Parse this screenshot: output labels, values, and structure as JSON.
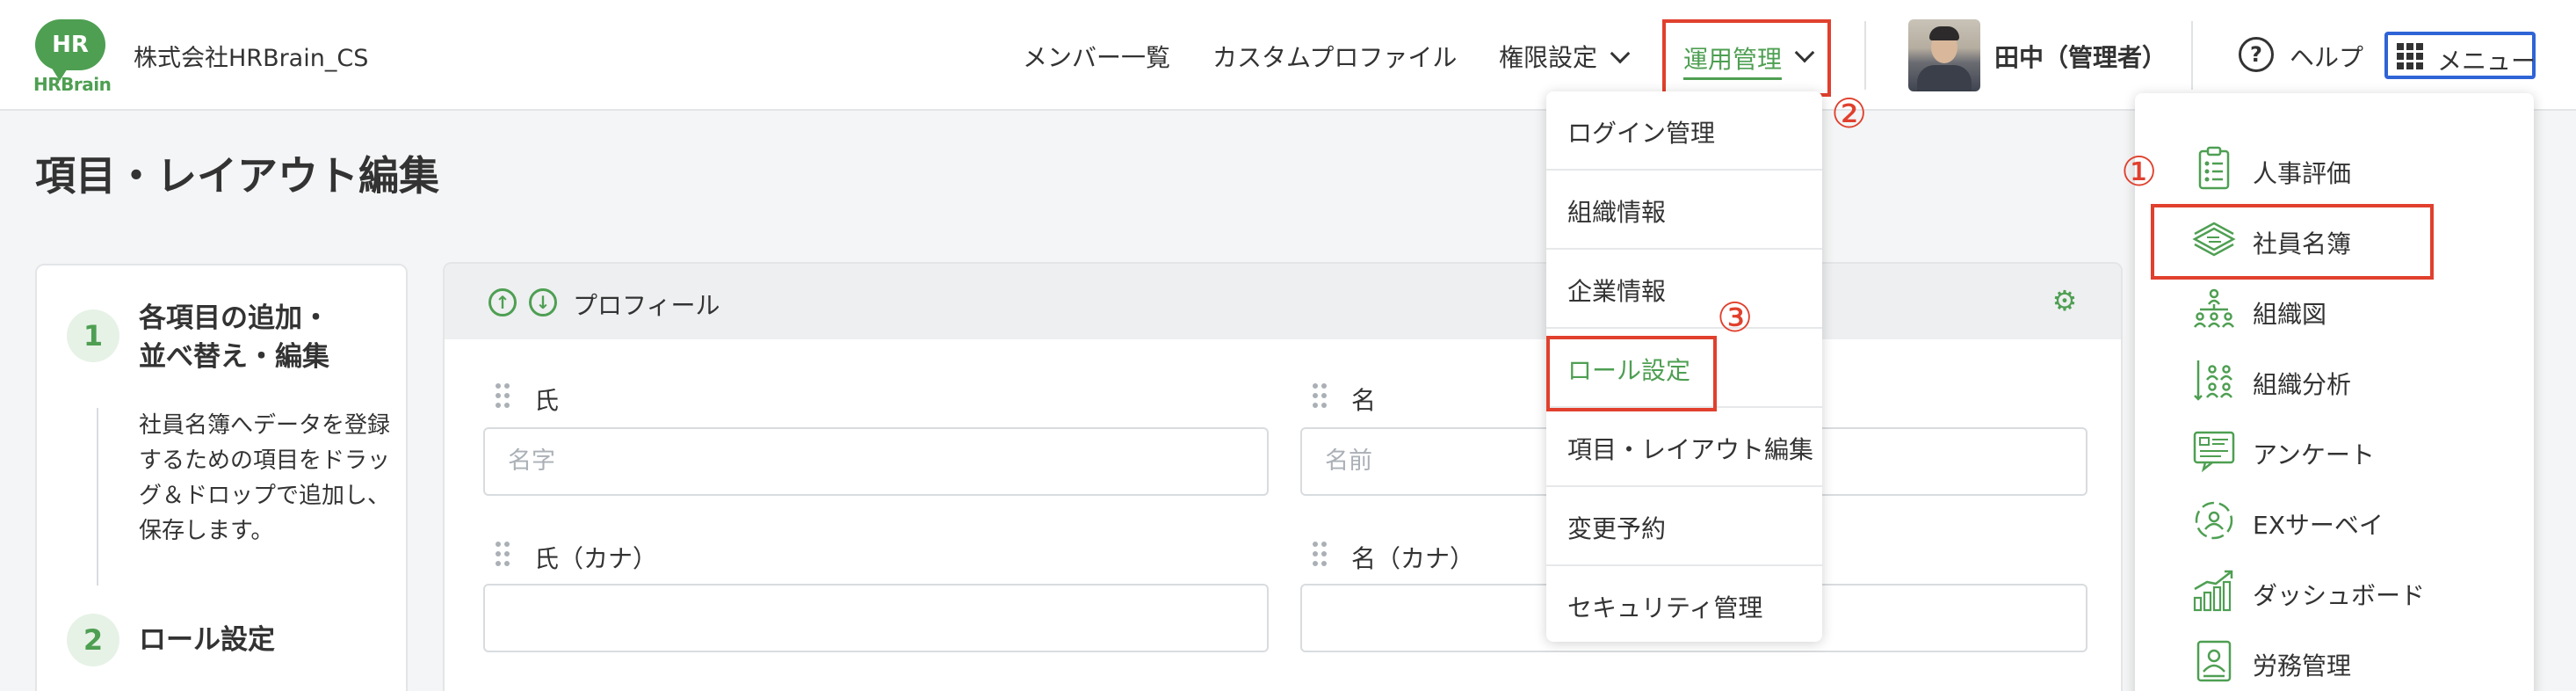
{
  "brand": {
    "logo_text": "HR",
    "logo_word": "HRBrain",
    "accent": "#4e9f52",
    "highlight": "#e0402d"
  },
  "header": {
    "company": "株式会社HRBrain_CS",
    "nav": {
      "members": "メンバー一覧",
      "custom_profile": "カスタムプロファイル",
      "permissions": "権限設定",
      "operations": "運用管理"
    },
    "user_name": "田中（管理者）",
    "help_icon_text": "?",
    "help": "ヘルプ",
    "menu": "メニュー"
  },
  "page_title": "項目・レイアウト編集",
  "steps": [
    {
      "num": "1",
      "title_line1": "各項目の追加・",
      "title_line2": "並べ替え・編集",
      "desc": "社員名簿へデータを登録するための項目をドラッグ＆ドロップで追加し、保存します。"
    },
    {
      "num": "2",
      "title_line1": "ロール設定"
    }
  ],
  "profile_card": {
    "title": "プロフィール",
    "up_arrow": "↑",
    "down_arrow": "↓",
    "gear": "⚙",
    "fields": [
      {
        "label": "氏",
        "placeholder": "名字"
      },
      {
        "label": "名",
        "placeholder": "名前"
      },
      {
        "label": "氏（カナ）",
        "placeholder": ""
      },
      {
        "label": "名（カナ）",
        "placeholder": ""
      }
    ]
  },
  "operations_dropdown": {
    "items": [
      "ログイン管理",
      "組織情報",
      "企業情報",
      "ロール設定",
      "項目・レイアウト編集",
      "変更予約",
      "セキュリティ管理"
    ],
    "highlighted_index": 3
  },
  "app_menu": {
    "items": [
      {
        "label": "人事評価",
        "icon": "clipboard-icon"
      },
      {
        "label": "社員名簿",
        "icon": "stacked-cards-icon"
      },
      {
        "label": "組織図",
        "icon": "org-chart-icon"
      },
      {
        "label": "組織分析",
        "icon": "org-analysis-icon"
      },
      {
        "label": "アンケート",
        "icon": "survey-icon"
      },
      {
        "label": "EXサーベイ",
        "icon": "ex-survey-icon"
      },
      {
        "label": "ダッシュボード",
        "icon": "dashboard-icon"
      },
      {
        "label": "労務管理",
        "icon": "labor-icon"
      }
    ],
    "highlighted_index": 1
  },
  "annotations": {
    "a1": "①",
    "a2": "②",
    "a3": "③"
  }
}
